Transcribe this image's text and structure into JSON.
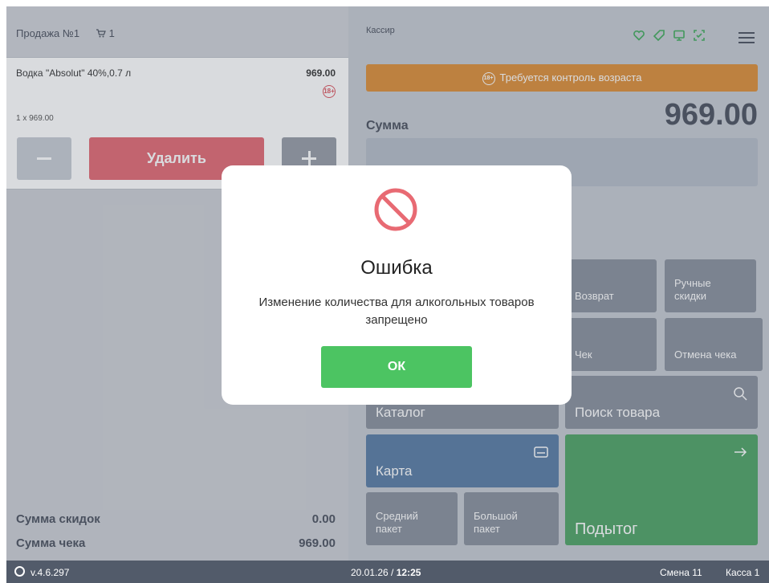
{
  "sale": {
    "title": "Продажа №1",
    "cart_count": "1"
  },
  "item": {
    "name": "Водка \"Absolut\" 40%,0.7 л",
    "price": "969.00",
    "age_badge": "18+",
    "qty_line": "1 x 969.00",
    "delete_label": "Удалить"
  },
  "totals": {
    "discount_label": "Сумма скидок",
    "discount_value": "0.00",
    "check_label": "Сумма чека",
    "check_value": "969.00"
  },
  "header": {
    "role": "Кассир",
    "icons": [
      "heart-icon",
      "tag-icon",
      "display-icon",
      "scan-icon",
      "menu-icon"
    ]
  },
  "age_banner": {
    "icon_text": "18+",
    "text": "Требуется контроль возраста"
  },
  "sum": {
    "label": "Сумма",
    "value": "969.00"
  },
  "tiles": {
    "vozvrat": "Возврат",
    "ruchnye": "Ручные скидки",
    "chek": "Чек",
    "otmena": "Отмена чека",
    "katalog": "Каталог",
    "poisk": "Поиск товара",
    "karta": "Карта",
    "sredniy": "Средний пакет",
    "bolshoy": "Большой пакет",
    "podytog": "Подытог"
  },
  "status": {
    "version": "v.4.6.297",
    "date": "20.01.26 /",
    "time": "12:25",
    "shift": "Смена 11",
    "kassa": "Касса 1"
  },
  "modal": {
    "title": "Ошибка",
    "message": "Изменение количества для алкогольных товаров запрещено",
    "ok_label": "ОК"
  },
  "colors": {
    "danger": "#e05a66",
    "warning": "#d98324",
    "success": "#4cc462",
    "card_blue": "#48709c",
    "subtotal_green": "#3d9a56"
  }
}
